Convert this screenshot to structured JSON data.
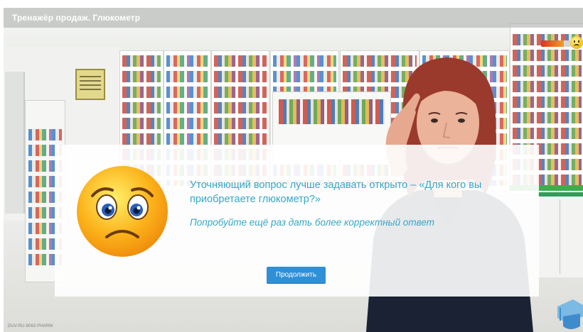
{
  "header": {
    "title": "Тренажёр продаж. Глюкометр"
  },
  "mood_meter": {
    "icon": "sad-face-icon",
    "level_fraction": 0.7,
    "colors": [
      "#d93324",
      "#f1a026"
    ]
  },
  "dialog": {
    "emoji_icon": "sad-face-icon",
    "message": "Уточняющий вопрос лучше задавать открыто – «Для кого вы приобретаете глюкометр?»",
    "hint": "Попробуйте ещё раз дать более корректный ответ",
    "continue_label": "Продолжить",
    "text_color": "#37a7c6",
    "button_color": "#2f8fd7"
  },
  "footer": {
    "code": "DUV-RU-8063 PHARM"
  },
  "corner_icon": "graduation-cap-icon"
}
